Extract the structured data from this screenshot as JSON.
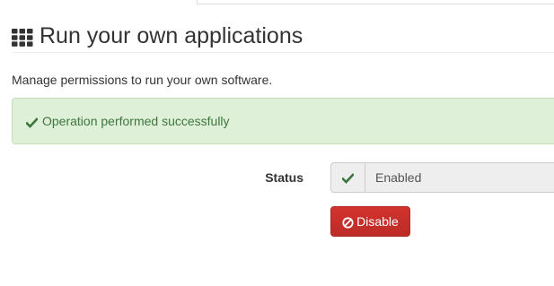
{
  "header": {
    "title": "Run your own applications",
    "icon": "th-grid-icon"
  },
  "description": "Manage permissions to run your own software.",
  "alert": {
    "icon": "check-icon",
    "message": "Operation performed successfully",
    "color": "#3c763d",
    "background": "#dff0d8"
  },
  "status": {
    "label": "Status",
    "icon": "check-icon",
    "value": "Enabled"
  },
  "actions": {
    "disable_icon": "ban-icon",
    "disable_label": "Disable",
    "button_color": "#c9302c"
  }
}
